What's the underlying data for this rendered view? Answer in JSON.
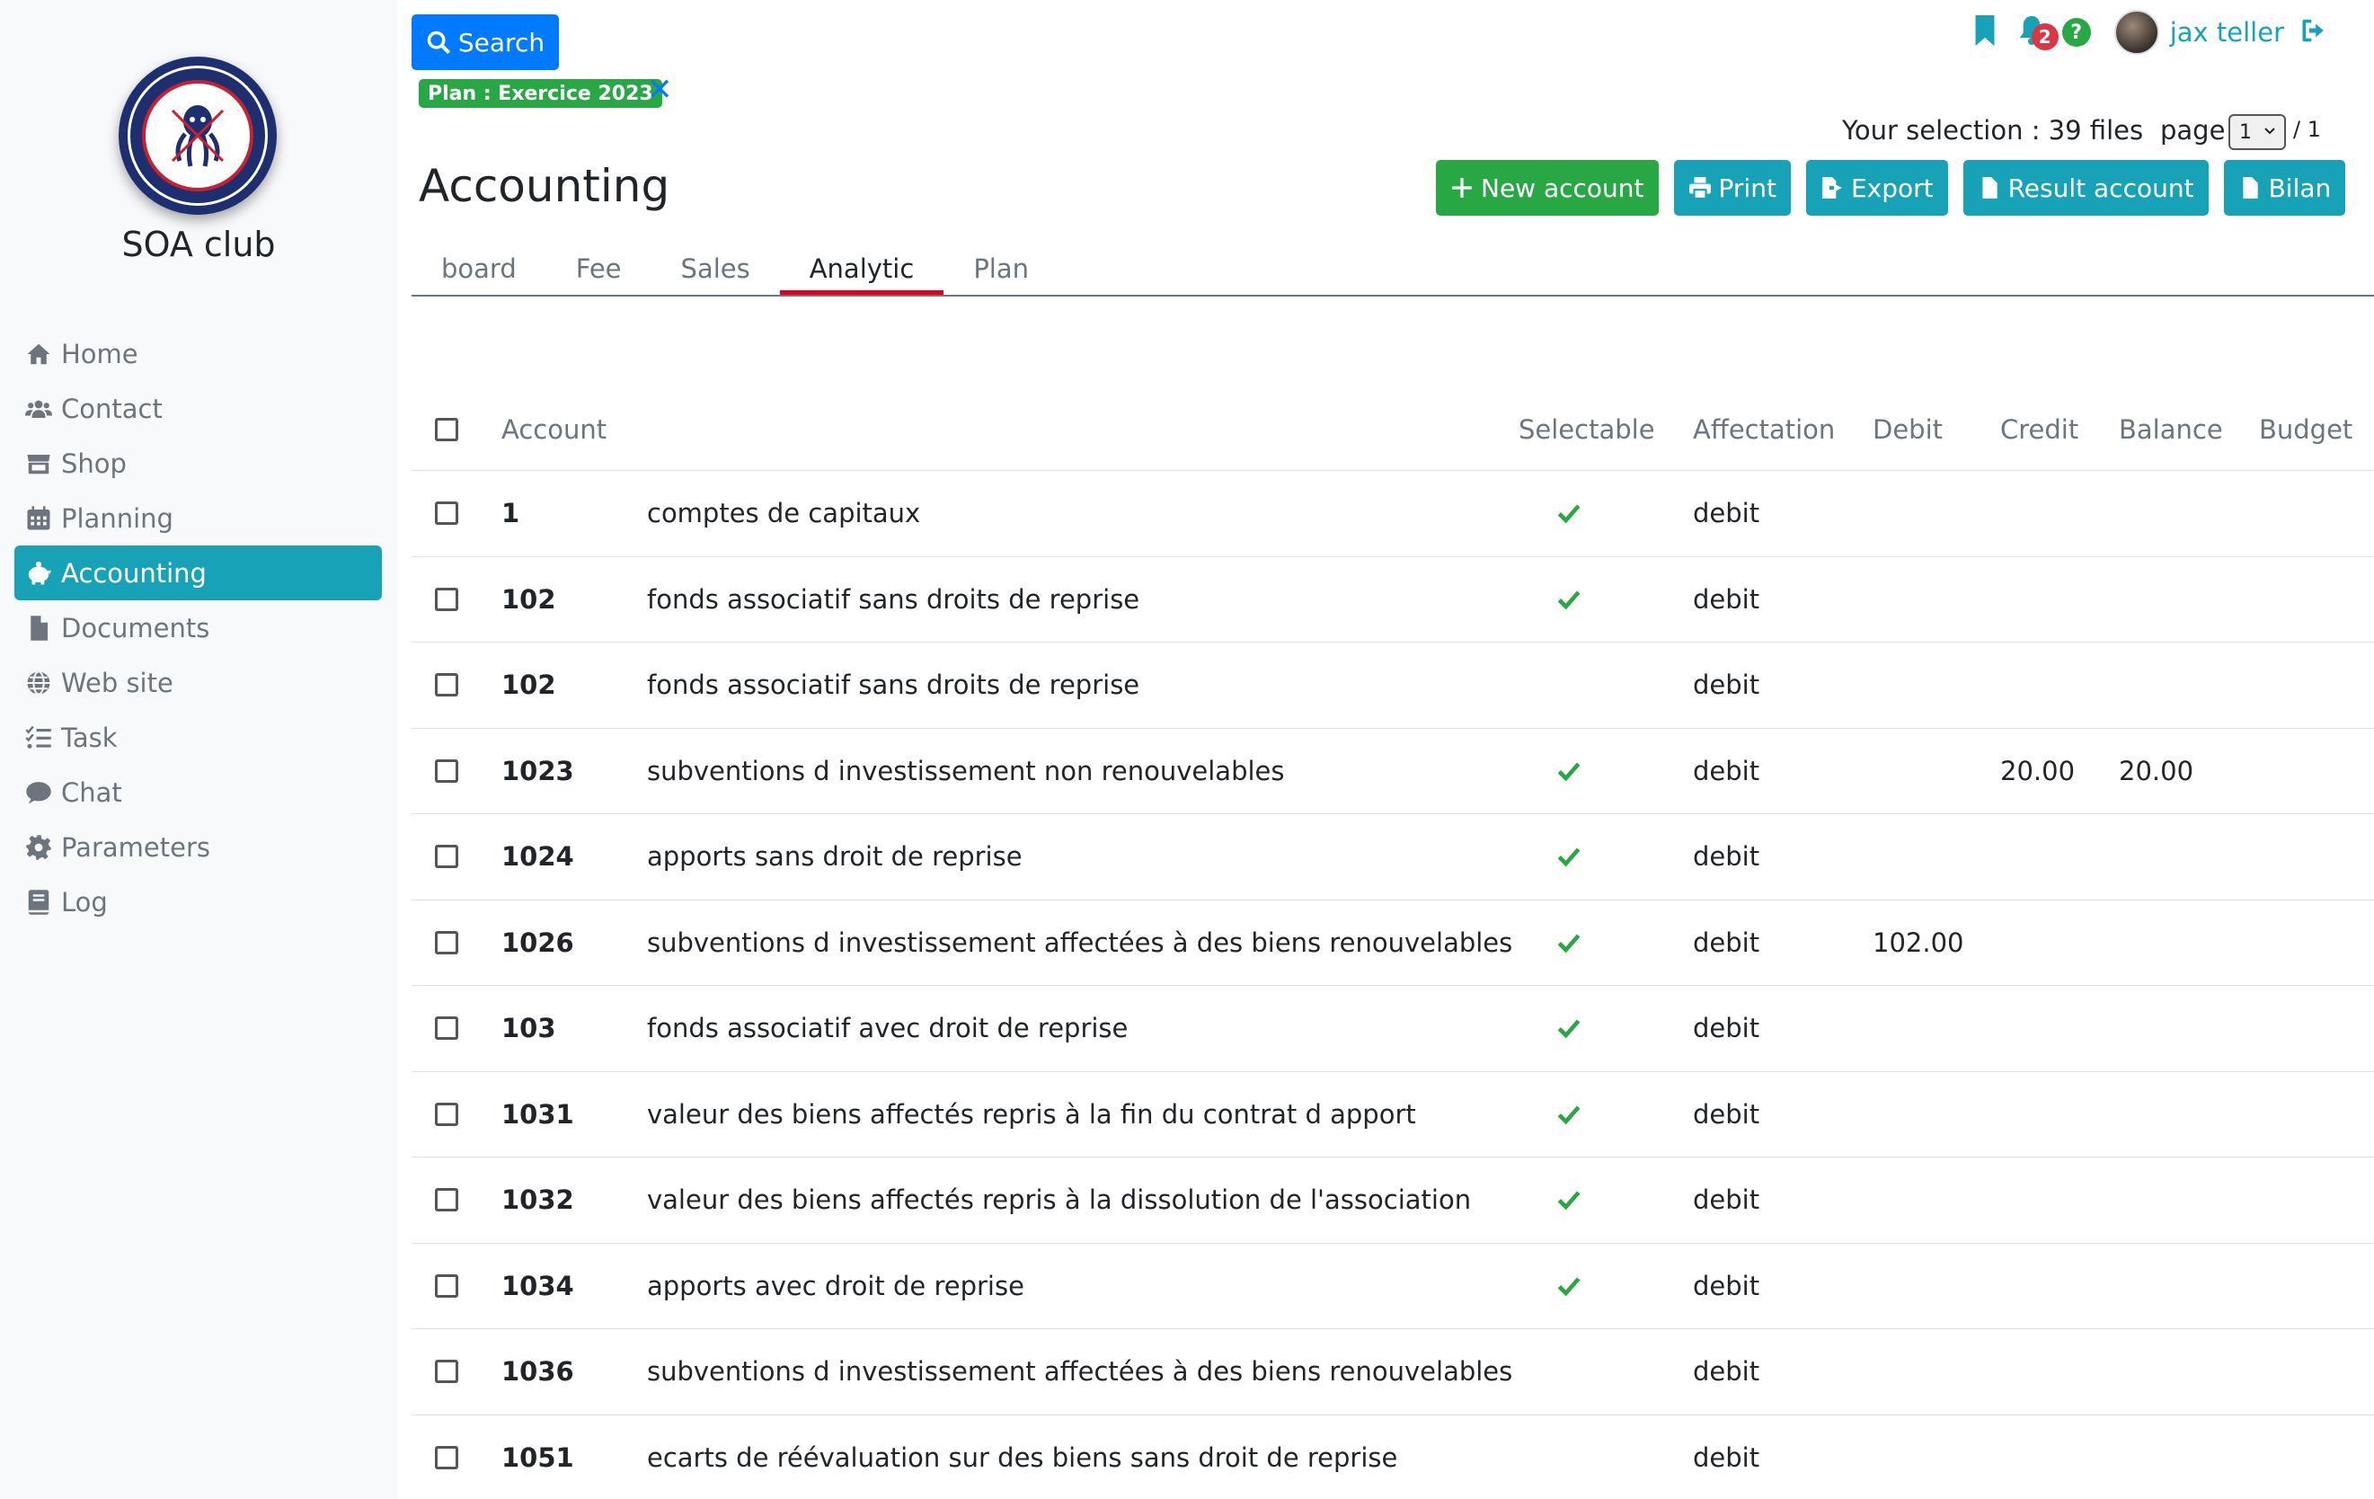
{
  "app": {
    "club_name": "SOA club"
  },
  "sidebar": {
    "items": [
      {
        "label": "Home",
        "icon": "home-icon",
        "active": false
      },
      {
        "label": "Contact",
        "icon": "users-icon",
        "active": false
      },
      {
        "label": "Shop",
        "icon": "shop-icon",
        "active": false
      },
      {
        "label": "Planning",
        "icon": "calendar-icon",
        "active": false
      },
      {
        "label": "Accounting",
        "icon": "piggy-bank-icon",
        "active": true
      },
      {
        "label": "Documents",
        "icon": "file-icon",
        "active": false
      },
      {
        "label": "Web site",
        "icon": "globe-icon",
        "active": false
      },
      {
        "label": "Task",
        "icon": "tasks-icon",
        "active": false
      },
      {
        "label": "Chat",
        "icon": "chat-icon",
        "active": false
      },
      {
        "label": "Parameters",
        "icon": "gear-icon",
        "active": false
      },
      {
        "label": "Log",
        "icon": "book-icon",
        "active": false
      }
    ]
  },
  "header": {
    "search_label": "Search",
    "filter_tag": "Plan : Exercice 2023",
    "filter_remove": "✕",
    "notifications_count": "2",
    "help_label": "?",
    "user_name": "jax teller",
    "selection_text": "Your selection : 39 files",
    "page_label": "page",
    "page_value": "1",
    "page_total": "/ 1"
  },
  "page": {
    "title": "Accounting",
    "actions": [
      {
        "label": "New account",
        "icon": "plus-icon",
        "style": "green"
      },
      {
        "label": "Print",
        "icon": "print-icon",
        "style": "info"
      },
      {
        "label": "Export",
        "icon": "export-icon",
        "style": "info"
      },
      {
        "label": "Result account",
        "icon": "file-icon",
        "style": "info"
      },
      {
        "label": "Bilan",
        "icon": "file-icon",
        "style": "info"
      }
    ],
    "tabs": [
      {
        "label": "board",
        "active": false
      },
      {
        "label": "Fee",
        "active": false
      },
      {
        "label": "Sales",
        "active": false
      },
      {
        "label": "Analytic",
        "active": true
      },
      {
        "label": "Plan",
        "active": false
      }
    ]
  },
  "table": {
    "columns": [
      "Account",
      "Selectable",
      "Affectation",
      "Debit",
      "Credit",
      "Balance",
      "Budget"
    ],
    "rows": [
      {
        "number": "1",
        "name": "comptes de capitaux",
        "selectable": true,
        "affectation": "debit",
        "debit": "",
        "credit": "",
        "balance": "",
        "budget": ""
      },
      {
        "number": "102",
        "name": "fonds associatif sans droits de reprise",
        "selectable": true,
        "affectation": "debit",
        "debit": "",
        "credit": "",
        "balance": "",
        "budget": ""
      },
      {
        "number": "102",
        "name": "fonds associatif sans droits de reprise",
        "selectable": false,
        "affectation": "debit",
        "debit": "",
        "credit": "",
        "balance": "",
        "budget": ""
      },
      {
        "number": "1023",
        "name": "subventions d investissement non renouvelables",
        "selectable": true,
        "affectation": "debit",
        "debit": "",
        "credit": "20.00",
        "balance": "20.00",
        "budget": ""
      },
      {
        "number": "1024",
        "name": "apports sans droit de reprise",
        "selectable": true,
        "affectation": "debit",
        "debit": "",
        "credit": "",
        "balance": "",
        "budget": ""
      },
      {
        "number": "1026",
        "name": "subventions d investissement affectées à des biens renouvelables",
        "selectable": true,
        "affectation": "debit",
        "debit": "102.00",
        "credit": "",
        "balance": "",
        "budget": ""
      },
      {
        "number": "103",
        "name": "fonds associatif avec droit de reprise",
        "selectable": true,
        "affectation": "debit",
        "debit": "",
        "credit": "",
        "balance": "",
        "budget": ""
      },
      {
        "number": "1031",
        "name": "valeur des biens affectés repris à la fin du contrat d apport",
        "selectable": true,
        "affectation": "debit",
        "debit": "",
        "credit": "",
        "balance": "",
        "budget": ""
      },
      {
        "number": "1032",
        "name": "valeur des biens affectés repris à la dissolution de l'association",
        "selectable": true,
        "affectation": "debit",
        "debit": "",
        "credit": "",
        "balance": "",
        "budget": ""
      },
      {
        "number": "1034",
        "name": "apports avec droit de reprise",
        "selectable": true,
        "affectation": "debit",
        "debit": "",
        "credit": "",
        "balance": "",
        "budget": ""
      },
      {
        "number": "1036",
        "name": "subventions d investissement affectées à des biens renouvelables",
        "selectable": false,
        "affectation": "debit",
        "debit": "",
        "credit": "",
        "balance": "",
        "budget": ""
      },
      {
        "number": "1051",
        "name": "ecarts de réévaluation sur des biens sans droit de reprise",
        "selectable": false,
        "affectation": "debit",
        "debit": "",
        "credit": "",
        "balance": "",
        "budget": ""
      }
    ]
  },
  "colors": {
    "primary": "#007bff",
    "info": "#17a2b8",
    "success": "#28a745",
    "danger": "#dc3545",
    "tab_underline": "#e0001b"
  }
}
